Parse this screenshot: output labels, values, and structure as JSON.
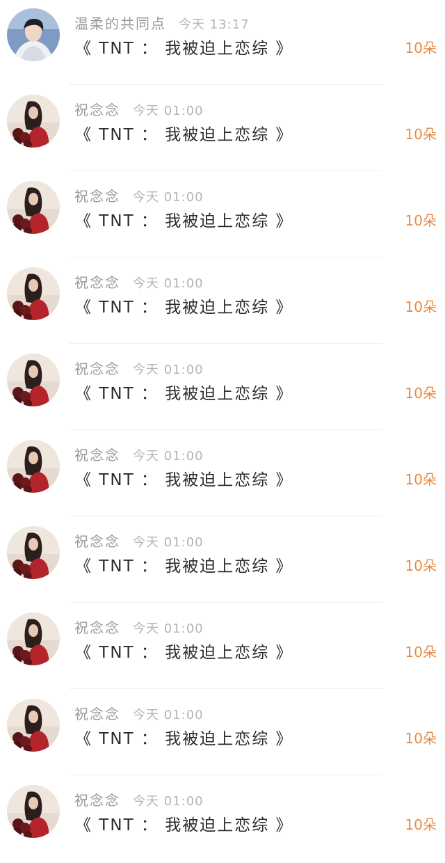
{
  "messages": [
    {
      "user": "温柔的共同点",
      "time": "今天 13:17",
      "text": "《 TNT ： 我被迫上恋综 》",
      "gift": "10朵",
      "avatar": "boy-avatar-icon"
    },
    {
      "user": "祝念念",
      "time": "今天 01:00",
      "text": "《 TNT ： 我被迫上恋综 》",
      "gift": "10朵",
      "avatar": "girl-roses-avatar-icon"
    },
    {
      "user": "祝念念",
      "time": "今天 01:00",
      "text": "《 TNT ： 我被迫上恋综 》",
      "gift": "10朵",
      "avatar": "girl-roses-avatar-icon"
    },
    {
      "user": "祝念念",
      "time": "今天 01:00",
      "text": "《 TNT ： 我被迫上恋综 》",
      "gift": "10朵",
      "avatar": "girl-roses-avatar-icon"
    },
    {
      "user": "祝念念",
      "time": "今天 01:00",
      "text": "《 TNT ： 我被迫上恋综 》",
      "gift": "10朵",
      "avatar": "girl-roses-avatar-icon"
    },
    {
      "user": "祝念念",
      "time": "今天 01:00",
      "text": "《 TNT ： 我被迫上恋综 》",
      "gift": "10朵",
      "avatar": "girl-roses-avatar-icon"
    },
    {
      "user": "祝念念",
      "time": "今天 01:00",
      "text": "《 TNT ： 我被迫上恋综 》",
      "gift": "10朵",
      "avatar": "girl-roses-avatar-icon"
    },
    {
      "user": "祝念念",
      "time": "今天 01:00",
      "text": "《 TNT ： 我被迫上恋综 》",
      "gift": "10朵",
      "avatar": "girl-roses-avatar-icon"
    },
    {
      "user": "祝念念",
      "time": "今天 01:00",
      "text": "《 TNT ： 我被迫上恋综 》",
      "gift": "10朵",
      "avatar": "girl-roses-avatar-icon"
    },
    {
      "user": "祝念念",
      "time": "今天 01:00",
      "text": "《 TNT ： 我被迫上恋综 》",
      "gift": "10朵",
      "avatar": "girl-roses-avatar-icon"
    }
  ],
  "colors": {
    "name": "#9a9a9a",
    "time": "#b4b4b4",
    "text": "#2b2b2b",
    "gift": "#e9883f",
    "divider": "#efefef"
  }
}
